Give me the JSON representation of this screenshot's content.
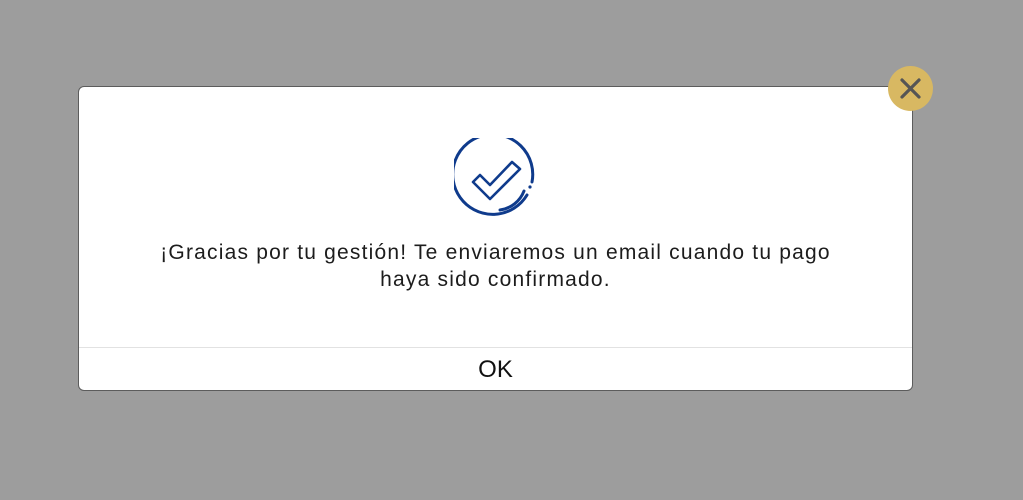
{
  "dialog": {
    "message_line1": "¡Gracias por tu gestión! Te enviaremos un email cuando tu pago",
    "message_line2": "haya sido confirmado.",
    "ok_label": "OK",
    "success_icon": "check-circle-icon",
    "close_icon": "close-icon"
  },
  "colors": {
    "overlay": "#9d9d9d",
    "modal_background": "#ffffff",
    "icon_blue": "#0f3b8c",
    "close_button": "#d8b862",
    "close_glyph": "#555555",
    "text": "#1c1c1c"
  }
}
